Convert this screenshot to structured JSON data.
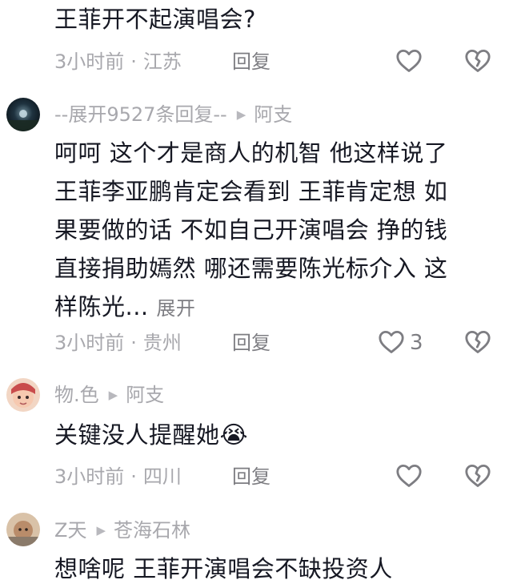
{
  "comments": [
    {
      "content": "王菲开不起演唱会?",
      "time": "3小时前",
      "location": "江苏",
      "reply_label": "回复",
      "like_count": ""
    },
    {
      "username": "--展开9527条回复--",
      "reply_to": "阿支",
      "content_lines": [
        "呵呵  这个才是商人的机智  他这样说了",
        "王菲李亚鹏肯定会看到  王菲肯定想  如",
        "果要做的话 不如自己开演唱会  挣的钱",
        "直接捐助嫣然  哪还需要陈光标介入  这",
        "样陈光..."
      ],
      "expand_label": "展开",
      "time": "3小时前",
      "location": "贵州",
      "reply_label": "回复",
      "like_count": "3"
    },
    {
      "username": "物.色",
      "reply_to": "阿支",
      "content": "关键没人提醒她",
      "emoji": "😭",
      "time": "3小时前",
      "location": "四川",
      "reply_label": "回复",
      "like_count": ""
    },
    {
      "username": "Z天",
      "reply_to": "苍海石林",
      "content": "想啥呢 王菲开演唱会不缺投资人"
    }
  ],
  "icons": {
    "like": "heart-outline-icon",
    "dislike": "broken-heart-icon",
    "reply_arrow": "play-triangle-icon"
  },
  "colors": {
    "text": "#161823",
    "meta": "#a8a8ad",
    "action": "#7d7d82"
  }
}
